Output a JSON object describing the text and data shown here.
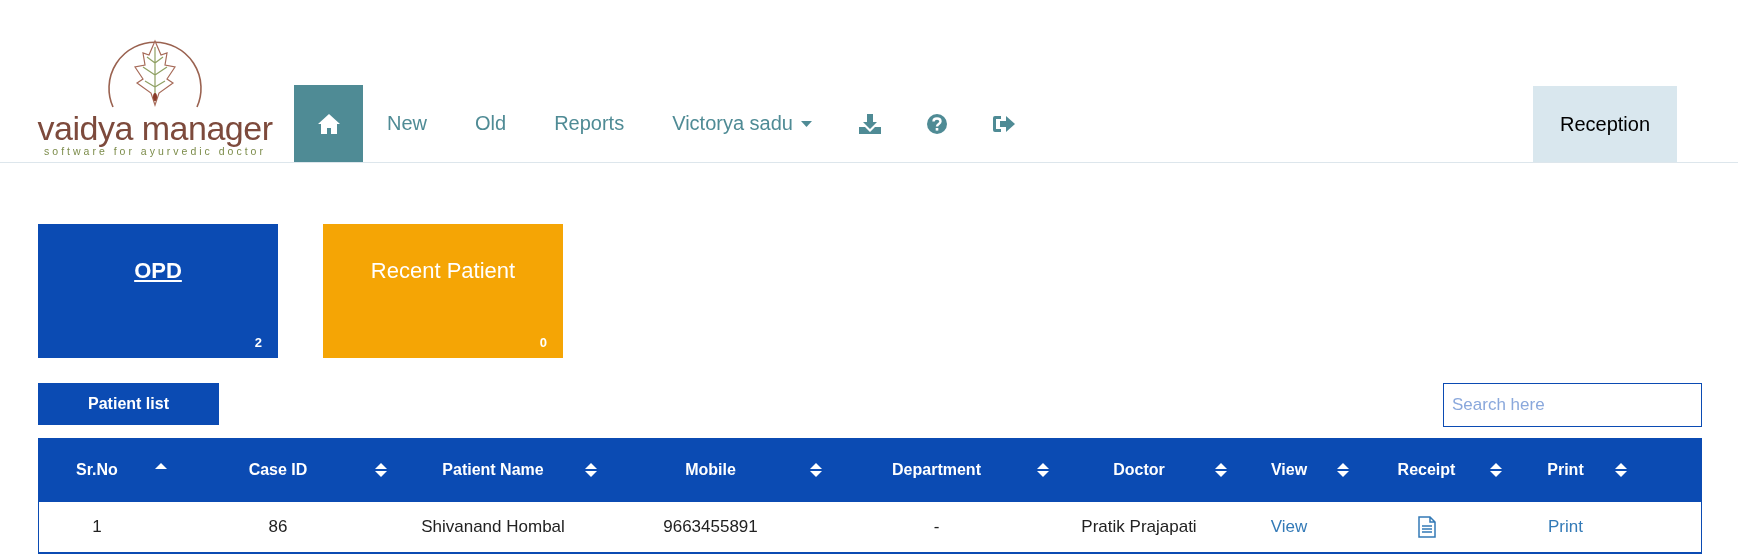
{
  "logo": {
    "name": "vaidya manager",
    "tagline": "software for ayurvedic doctor"
  },
  "nav": [
    {
      "kind": "home",
      "selected": true
    },
    {
      "kind": "link",
      "label": "New",
      "selected": false
    },
    {
      "kind": "link",
      "label": "Old",
      "selected": false
    },
    {
      "kind": "link",
      "label": "Reports",
      "selected": false
    },
    {
      "kind": "dropdown",
      "label": "Victorya sadu",
      "selected": false
    },
    {
      "kind": "download",
      "selected": false
    },
    {
      "kind": "help",
      "selected": false
    },
    {
      "kind": "logout",
      "selected": false
    }
  ],
  "role_badge": "Reception",
  "cards": [
    {
      "title": "OPD",
      "count": "2",
      "color": "#0b4bb3",
      "underlined": true
    },
    {
      "title": "Recent Patient",
      "count": "0",
      "color": "#f5a505",
      "underlined": false
    }
  ],
  "patient_list_button": "Patient list",
  "search": {
    "placeholder": "Search here"
  },
  "table": {
    "columns": [
      {
        "label": "Sr.No",
        "sorted": true
      },
      {
        "label": "Case ID",
        "sorted": false
      },
      {
        "label": "Patient Name",
        "sorted": false
      },
      {
        "label": "Mobile",
        "sorted": false
      },
      {
        "label": "Department",
        "sorted": false
      },
      {
        "label": "Doctor",
        "sorted": false
      },
      {
        "label": "View",
        "sorted": false
      },
      {
        "label": "Receipt",
        "sorted": false
      },
      {
        "label": "Print",
        "sorted": false
      }
    ],
    "rows": [
      [
        {
          "kind": "text",
          "text": "1"
        },
        {
          "kind": "text",
          "text": "86"
        },
        {
          "kind": "text",
          "text": "Shivanand Hombal"
        },
        {
          "kind": "text",
          "text": "9663455891"
        },
        {
          "kind": "text",
          "text": "-"
        },
        {
          "kind": "text",
          "text": "Pratik Prajapati"
        },
        {
          "kind": "link",
          "text": "View"
        },
        {
          "kind": "document"
        },
        {
          "kind": "link",
          "text": "Print"
        }
      ]
    ]
  }
}
